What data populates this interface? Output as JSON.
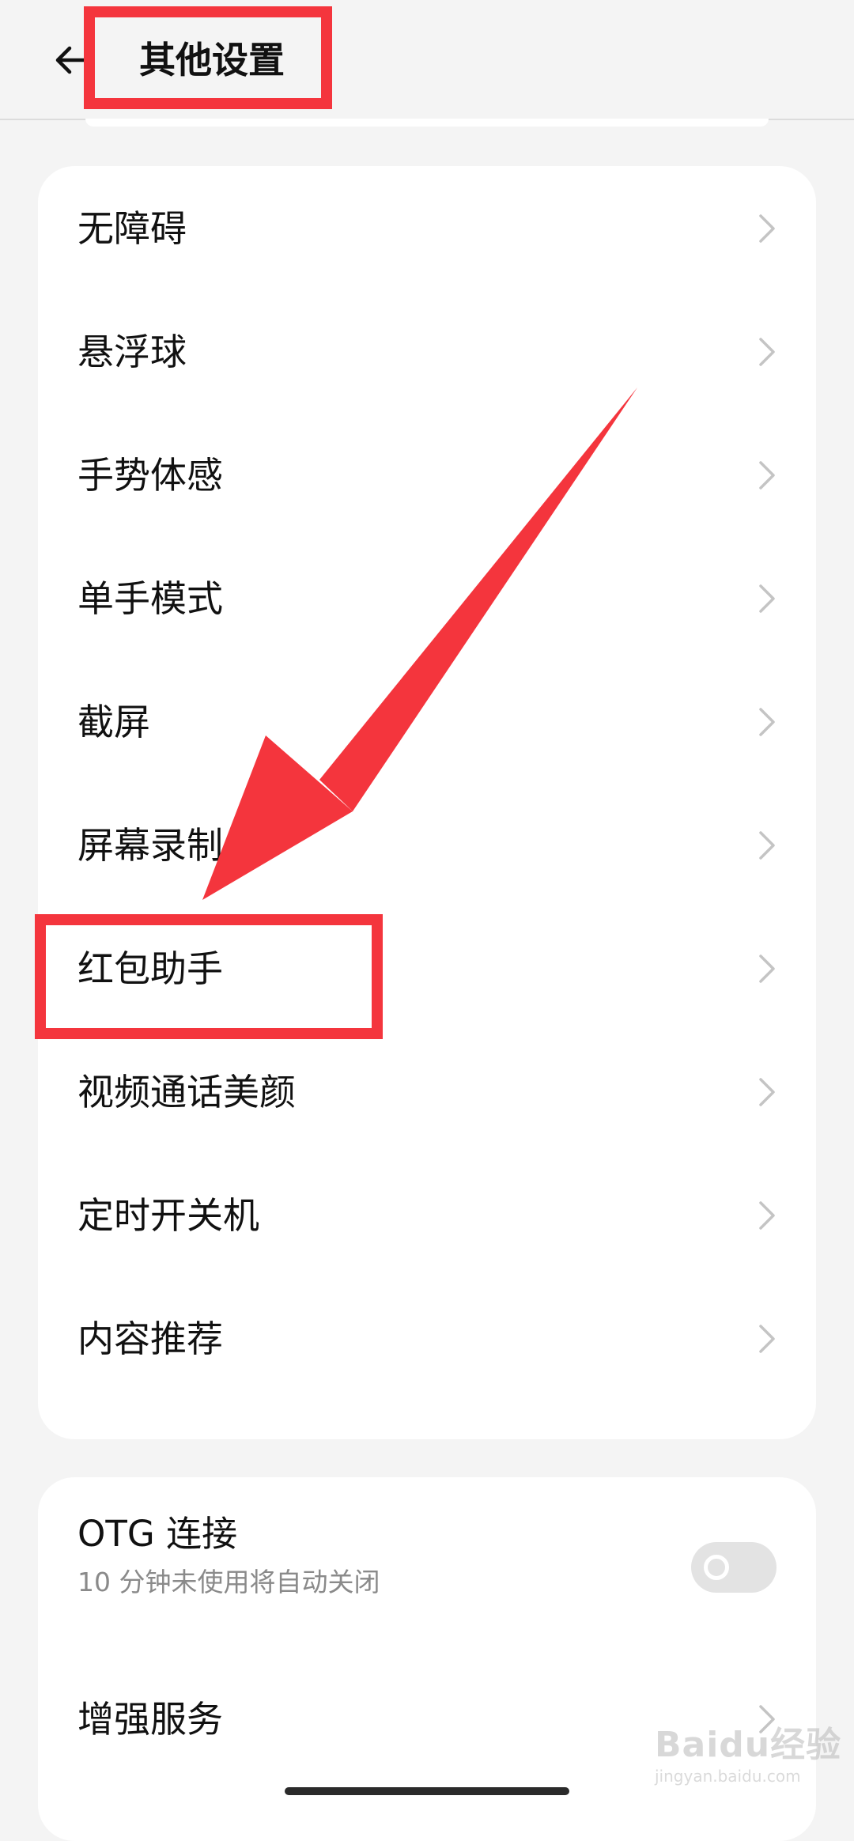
{
  "header": {
    "title": "其他设置",
    "back_icon": "back-arrow-icon"
  },
  "main_list": {
    "items": [
      {
        "label": "无障碍"
      },
      {
        "label": "悬浮球"
      },
      {
        "label": "手势体感"
      },
      {
        "label": "单手模式"
      },
      {
        "label": "截屏"
      },
      {
        "label": "屏幕录制"
      },
      {
        "label": "红包助手"
      },
      {
        "label": "视频通话美颜"
      },
      {
        "label": "定时开关机"
      },
      {
        "label": "内容推荐"
      }
    ]
  },
  "second_list": {
    "otg": {
      "title": "OTG 连接",
      "subtitle": "10 分钟未使用将自动关闭",
      "enabled": false
    },
    "enhanced": {
      "label": "增强服务"
    }
  },
  "watermark": {
    "brand": "Baidu经验",
    "url": "jingyan.baidu.com"
  },
  "colors": {
    "background": "#f4f4f4",
    "card": "#ffffff",
    "annotation": "#f4353d",
    "chevron": "#c4c4c4"
  }
}
